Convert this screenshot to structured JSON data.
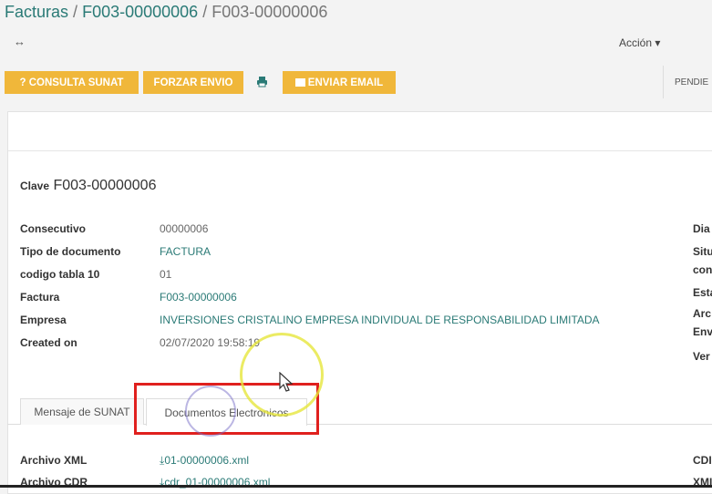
{
  "breadcrumb": {
    "root": "Facturas",
    "parent": "F003-00000006",
    "current": "F003-00000006",
    "sep": "/"
  },
  "topbar": {
    "toggle_icon": "↔",
    "action_label": "Acción ▾"
  },
  "toolbar": {
    "consulta": "? CONSULTA SUNAT",
    "forzar": "FORZAR ENVIO",
    "print_icon": "printer-icon",
    "enviar": "ENVIAR EMAIL",
    "status": "PENDIE"
  },
  "colors": {
    "accent": "#f0b73a",
    "link": "#2a7a76",
    "highlight": "#e0201e"
  },
  "form": {
    "clave_label": "Clave",
    "clave_value": "F003-00000006",
    "fields": [
      {
        "label": "Consecutivo",
        "value": "00000006"
      },
      {
        "label": "Tipo de documento",
        "value": "FACTURA"
      },
      {
        "label": "codigo tabla 10",
        "value": "01"
      },
      {
        "label": "Factura",
        "value": "F003-00000006"
      },
      {
        "label": "Empresa",
        "value": "INVERSIONES CRISTALINO EMPRESA INDIVIDUAL DE RESPONSABILIDAD LIMITADA"
      },
      {
        "label": "Created on",
        "value": "02/07/2020 19:58:19"
      }
    ],
    "right_labels": [
      "Dia",
      "Situ",
      "con",
      "Esta",
      "Arc",
      "Env",
      "Ver"
    ]
  },
  "tabs": [
    {
      "label": "Mensaje de SUNAT"
    },
    {
      "label": "Documentos Electronicos",
      "active": true
    }
  ],
  "documents": [
    {
      "label": "Archivo XML",
      "file": "01-00000006.xml"
    },
    {
      "label": "Archivo CDR",
      "file": "cdr_01-00000006.xml"
    }
  ],
  "right_doc_labels": [
    "CDI",
    "XMI"
  ]
}
